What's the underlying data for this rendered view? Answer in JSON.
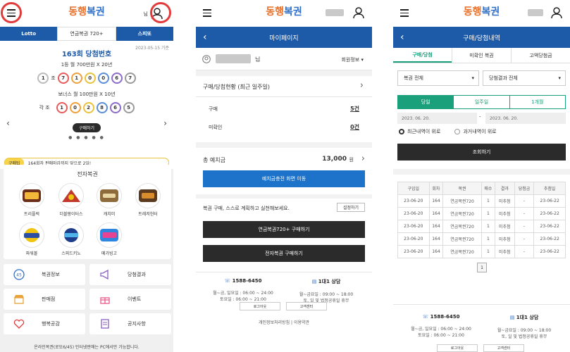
{
  "screen1": {
    "logo": {
      "part1": "동행",
      "part2": "복권"
    },
    "greeting": "님",
    "tabs": [
      "Lotto",
      "연금복권 720+",
      "스피또"
    ],
    "draw_date": "2023-05-15 기준",
    "draw_title": "163회 당첨번호",
    "first_prize": "1등 월 700만원 X 20년",
    "main_numbers": {
      "group": "1",
      "unit": "조",
      "digits": [
        "7",
        "1",
        "0",
        "0",
        "6",
        "7"
      ]
    },
    "bonus_prize": "보너스 월 100만원 X 10년",
    "bonus_numbers": {
      "label": "각 조",
      "digits": [
        "1",
        "0",
        "2",
        "8",
        "6",
        "5"
      ]
    },
    "buy_button": "구매하기",
    "notice_label": "구매팁",
    "notice_text": "164회차 판매마감까지 앞으로 2일!",
    "section_title": "전자복권",
    "games": [
      "트리플럭",
      "더블팡이터스",
      "캐치미",
      "트레저헌터",
      "파워볼",
      "스피드키노",
      "메가빙고"
    ],
    "menu": [
      [
        "복권정보",
        "당첨결과"
      ],
      [
        "판매점",
        "이벤트"
      ],
      [
        "행복공감",
        "공지사항"
      ]
    ],
    "footer_text": "온라인복권(로또6/45) 인터넷판매는 PC에서만 가능합니다."
  },
  "screen2": {
    "logo": {
      "part1": "동행",
      "part2": "복권"
    },
    "title": "마이페이지",
    "user_suffix": "님",
    "member_info": "회원정보",
    "status_title": "구매/당첨현황 (최근 일주일)",
    "purchase_label": "구매",
    "purchase_value": "5건",
    "unchecked_label": "미확인",
    "unchecked_value": "0건",
    "deposit_label": "총 예치금",
    "deposit_value": "13,000",
    "deposit_unit": "원",
    "charge_button": "예치금충전 화면 이동",
    "plan_text": "복권 구매, 스스로 계획하고 실천해보세요.",
    "plan_button": "설정하기",
    "pension_button": "연금복권720+ 구매하기",
    "instant_button": "전자복권 구매하기",
    "phone": "1588-6450",
    "phone_hours": [
      "월~금, 일요일 : 06:00 ~ 24:00",
      "토요일 : 06:00 ~ 21:00"
    ],
    "chat": "1대1 상담",
    "chat_hours": [
      "월~금요일 : 09:00 ~ 18:00",
      "토, 일 및 법정공휴일 휴무"
    ],
    "login_btn": "로그아웃",
    "center_btn": "고객센터",
    "privacy": "개인정보처리방침",
    "terms": "이용약관"
  },
  "screen3": {
    "logo": {
      "part1": "동행",
      "part2": "복권"
    },
    "title": "구매/당첨내역",
    "tabs": [
      "구매/당첨",
      "미확인 복권",
      "고액당첨금"
    ],
    "select_lottery": "복권 전체",
    "select_result": "당첨결과 전체",
    "period_tabs": [
      "당일",
      "일주일",
      "1개월"
    ],
    "date_from": "2023. 06. 20.",
    "date_to": "2023. 06. 20.",
    "sort_options": [
      "최근내역이 위로",
      "과거내역이 위로"
    ],
    "search_button": "조회하기",
    "columns": [
      "구입일",
      "회차",
      "복권",
      "매수",
      "결과",
      "당첨금",
      "추첨일"
    ],
    "rows": [
      [
        "23-06-20",
        "164",
        "연금복권720",
        "1",
        "미추첨",
        "-",
        "23-06-22"
      ],
      [
        "23-06-20",
        "164",
        "연금복권720",
        "1",
        "미추첨",
        "-",
        "23-06-22"
      ],
      [
        "23-06-20",
        "164",
        "연금복권720",
        "1",
        "미추첨",
        "-",
        "23-06-22"
      ],
      [
        "23-06-20",
        "164",
        "연금복권720",
        "1",
        "미추첨",
        "-",
        "23-06-22"
      ],
      [
        "23-06-20",
        "164",
        "연금복권720",
        "1",
        "미추첨",
        "-",
        "23-06-22"
      ]
    ],
    "page": "1",
    "phone": "1588-6450",
    "phone_hours": [
      "월~금, 일요일 : 06:00 ~ 24:00",
      "토요일 : 06:00 ~ 21:00"
    ],
    "chat": "1대1 상담",
    "chat_hours": [
      "월~금요일 : 09:00 ~ 18:00",
      "토, 일 및 법정공휴일 휴무"
    ],
    "login_btn": "로그아웃",
    "center_btn": "고객센터"
  },
  "colors": {
    "brand_blue": "#1d5aa8",
    "button_blue": "#1d73c9",
    "highlight": "#e23b3b",
    "tab_green": "#1aa07a"
  }
}
